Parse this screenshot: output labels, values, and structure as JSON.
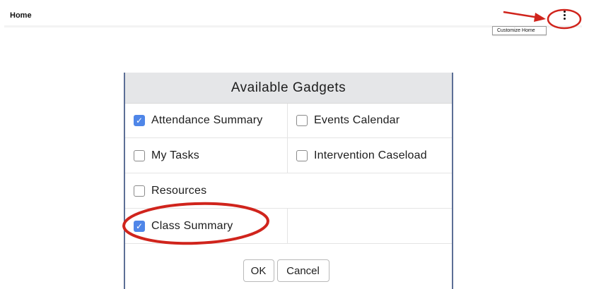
{
  "header": {
    "title": "Home",
    "menu_icon": "more-vertical-icon",
    "tooltip": "Customize Home"
  },
  "dialog": {
    "title": "Available Gadgets",
    "gadgets": [
      {
        "label": "Attendance Summary",
        "checked": true
      },
      {
        "label": "Events Calendar",
        "checked": false
      },
      {
        "label": "My Tasks",
        "checked": false
      },
      {
        "label": "Intervention Caseload",
        "checked": false
      },
      {
        "label": "Resources",
        "checked": false
      },
      {
        "label": "Class Summary",
        "checked": true
      }
    ],
    "ok_label": "OK",
    "cancel_label": "Cancel"
  },
  "colors": {
    "annotation": "#d0241c",
    "checkbox_checked": "#4f86e8",
    "dialog_border": "#5c6f96",
    "header_bg": "#e5e6e8"
  }
}
